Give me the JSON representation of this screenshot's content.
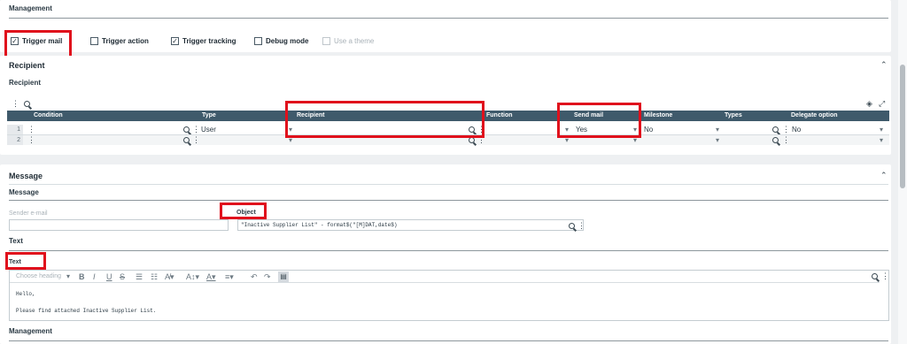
{
  "management_top": {
    "title": "Management",
    "checkboxes": [
      {
        "label": "Trigger mail",
        "checked": true,
        "disabled": false
      },
      {
        "label": "Trigger action",
        "checked": false,
        "disabled": false
      },
      {
        "label": "Trigger tracking",
        "checked": true,
        "disabled": false
      },
      {
        "label": "Debug mode",
        "checked": false,
        "disabled": false
      },
      {
        "label": "Use a theme",
        "checked": false,
        "disabled": true
      }
    ]
  },
  "recipient": {
    "section_title": "Recipient",
    "block_title": "Recipient",
    "columns": [
      "Condition",
      "Type",
      "Recipient",
      "Function",
      "Send mail",
      "Milestone",
      "Types",
      "Delegate option"
    ],
    "rows": [
      {
        "num": "1",
        "type": "User",
        "send_mail": "Yes",
        "milestone": "No",
        "delegate": "No"
      },
      {
        "num": "2",
        "type": "",
        "send_mail": "",
        "milestone": "",
        "delegate": ""
      }
    ]
  },
  "message": {
    "section_title": "Message",
    "block_title": "Message",
    "sender_label": "Sender e-mail",
    "object_label": "Object",
    "object_value": "\"Inactive Supplier List\" - format$(\"[M]DAT,date$)",
    "text_block_title": "Text",
    "text_label": "Text",
    "heading_select": "Choose heading",
    "editor_lines": [
      "Hello,",
      "Please find attached Inactive Supplier List."
    ]
  },
  "management_bottom": {
    "title": "Management"
  },
  "colors": {
    "header_bg": "#3f5a6b",
    "highlight": "#e0101c"
  }
}
